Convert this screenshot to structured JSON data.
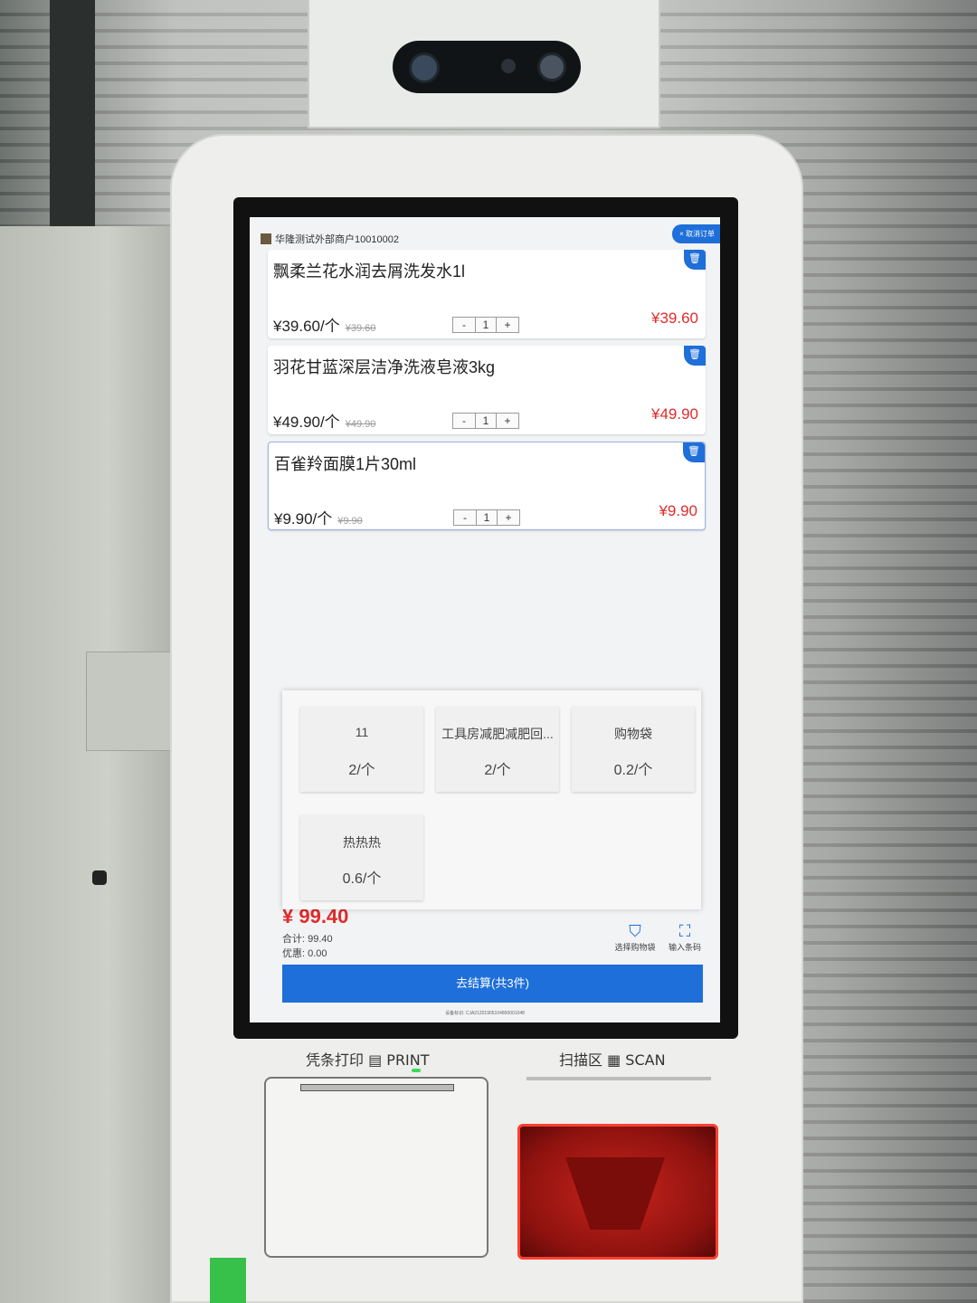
{
  "merchant": "华隆测试外部商户10010002",
  "cancel_order_label": "× 取消订单",
  "items": [
    {
      "name": "飘柔兰花水润去屑洗发水1l",
      "unit_price": "¥39.60/个",
      "original_price": "¥39.60",
      "minus": "-",
      "quantity": "1",
      "plus": "+",
      "total": "¥39.60"
    },
    {
      "name": "羽花甘蓝深层洁净洗液皂液3kg",
      "unit_price": "¥49.90/个",
      "original_price": "¥49.90",
      "minus": "-",
      "quantity": "1",
      "plus": "+",
      "total": "¥49.90"
    },
    {
      "name": "百雀羚面膜1片30ml",
      "unit_price": "¥9.90/个",
      "original_price": "¥9.90",
      "minus": "-",
      "quantity": "1",
      "plus": "+",
      "total": "¥9.90"
    }
  ],
  "popup_products": [
    {
      "name": "11",
      "price": "2/个"
    },
    {
      "name": "工具房减肥减肥回...",
      "price": "2/个"
    },
    {
      "name": "购物袋",
      "price": "0.2/个"
    },
    {
      "name": "热热热",
      "price": "0.6/个"
    }
  ],
  "big_total": "¥ 99.40",
  "summary": {
    "total": "合计: 99.40",
    "discount": "优惠: 0.00"
  },
  "select_bag_label": "选择购物袋",
  "enter_code_label": "输入条码",
  "checkout_label": "去结算(共3件)",
  "device_id": "设备标识: CJA21201905104800001048",
  "hardware": {
    "print_label": "凭条打印 ▤ PRINT",
    "scan_label": "扫描区 ▦ SCAN"
  },
  "colors": {
    "accent": "#1e6fd9",
    "price_red": "#e12b2b"
  }
}
